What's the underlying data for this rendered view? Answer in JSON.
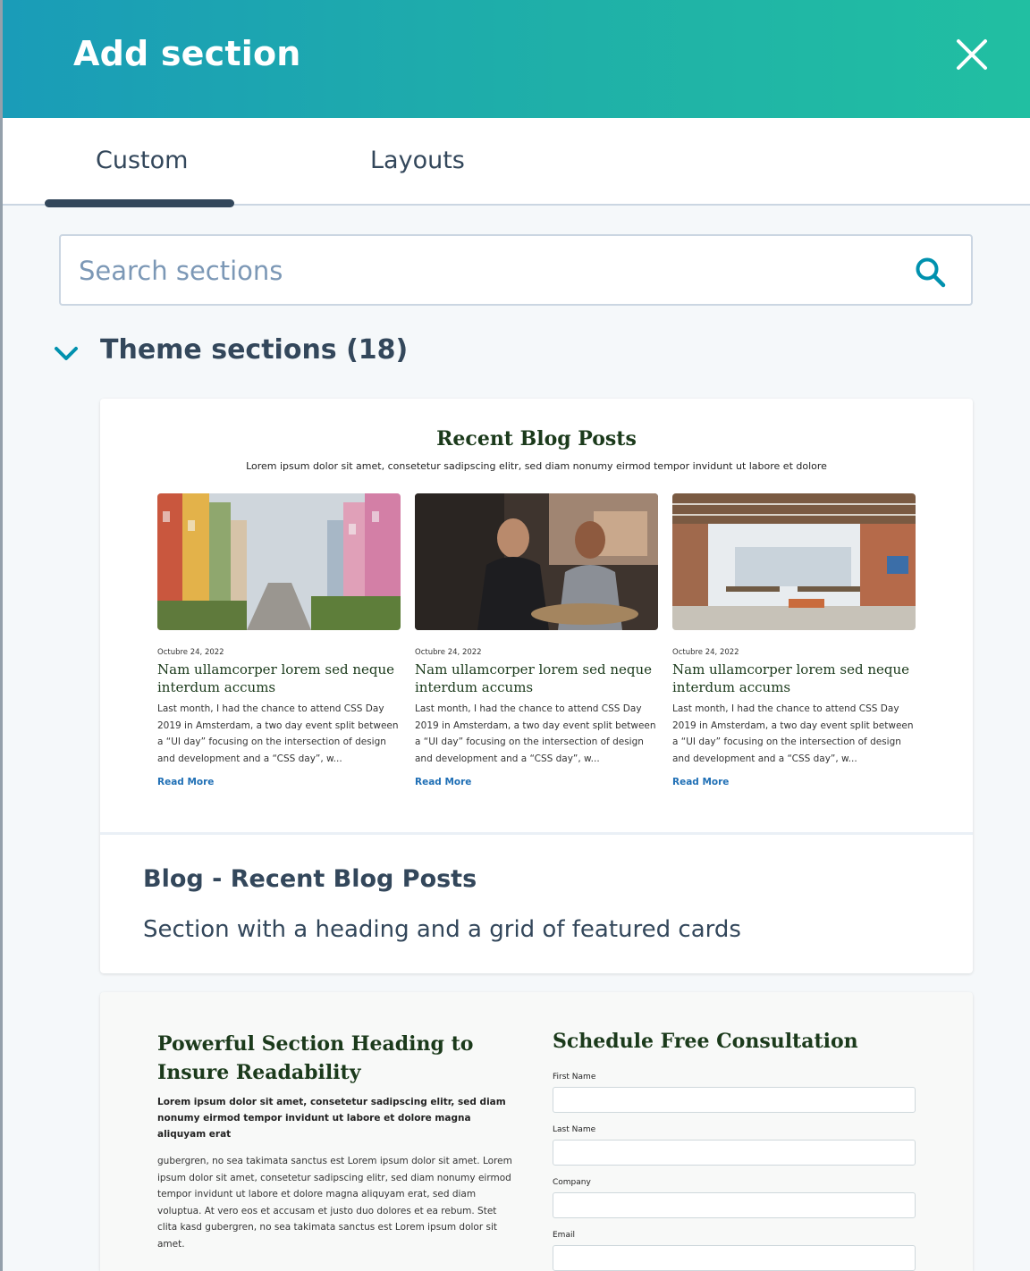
{
  "header": {
    "title": "Add section",
    "close_icon": "close-icon"
  },
  "tabs": [
    {
      "label": "Custom",
      "active": true
    },
    {
      "label": "Layouts",
      "active": false
    }
  ],
  "search": {
    "placeholder": "Search sections",
    "value": ""
  },
  "theme_sections": {
    "title": "Theme sections (18)",
    "expanded": true
  },
  "cards": [
    {
      "name": "Blog - Recent Blog Posts",
      "description": "Section with a heading and a grid of featured cards",
      "preview": {
        "title": "Recent Blog Posts",
        "subtitle": "Lorem ipsum dolor sit amet, consetetur sadipscing elitr, sed diam nonumy eirmod tempor invidunt ut labore et dolore",
        "posts": [
          {
            "image": "colorful-street-photo",
            "date": "Octubre 24, 2022",
            "title": "Nam ullamcorper lorem sed neque interdum accums",
            "excerpt": "Last month, I had the chance to attend CSS Day 2019 in Amsterdam, a two day event split between a “UI day” focusing on the intersection of design and development and a “CSS day”, w...",
            "link": "Read More"
          },
          {
            "image": "cafe-people-photo",
            "date": "Octubre 24, 2022",
            "title": "Nam ullamcorper lorem sed neque interdum accums",
            "excerpt": "Last month, I had the chance to attend CSS Day 2019 in Amsterdam, a two day event split between a “UI day” focusing on the intersection of design and development and a “CSS day”, w...",
            "link": "Read More"
          },
          {
            "image": "office-interior-photo",
            "date": "Octubre 24, 2022",
            "title": "Nam ullamcorper lorem sed neque interdum accums",
            "excerpt": "Last month, I had the chance to attend CSS Day 2019 in Amsterdam, a two day event split between a “UI day” focusing on the intersection of design and development and a “CSS day”, w...",
            "link": "Read More"
          }
        ]
      }
    },
    {
      "preview": {
        "heading": "Powerful Section Heading to Insure Readability",
        "bold_text": "Lorem ipsum dolor sit amet, consetetur sadipscing elitr, sed diam nonumy eirmod tempor invidunt ut labore et dolore magna aliquyam erat",
        "body": "gubergren, no sea takimata sanctus est Lorem ipsum dolor sit amet. Lorem ipsum dolor sit amet, consetetur sadipscing elitr, sed diam nonumy eirmod tempor invidunt ut labore et dolore magna aliquyam erat, sed diam voluptua. At vero eos et accusam et justo duo dolores et ea rebum. Stet clita kasd gubergren, no sea takimata sanctus est Lorem ipsum dolor sit amet.",
        "form_title": "Schedule Free Consultation",
        "fields": [
          "First Name",
          "Last Name",
          "Company",
          "Email"
        ]
      }
    }
  ],
  "colors": {
    "header_start": "#1a9cb8",
    "header_end": "#21bfa2",
    "text": "#33475b",
    "accent": "#0091ae"
  }
}
